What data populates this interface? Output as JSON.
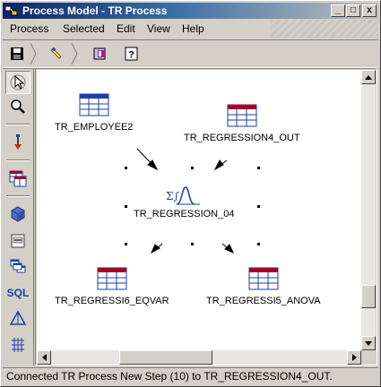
{
  "window": {
    "title": "Process Model - TR Process",
    "controls": {
      "minimize": "_",
      "maximize": "□",
      "close": "x"
    }
  },
  "menu": {
    "items": [
      "Process",
      "Selected",
      "Edit",
      "View",
      "Help"
    ]
  },
  "toolbar": {
    "buttons": [
      "save-icon",
      "hand-icon",
      "process-icon",
      "help-icon"
    ],
    "help_glyph": "?"
  },
  "palette": {
    "tools": [
      "pointer-icon",
      "zoom-icon",
      "link-icon",
      "table-source-icon",
      "cube-icon",
      "file-icon",
      "tables-icon",
      "sql-icon",
      "triangle-icon",
      "grid-icon"
    ],
    "sql_label": "SQL"
  },
  "canvas": {
    "nodes": {
      "employee2": "TR_EMPLOYEE2",
      "regression4_out": "TR_REGRESSION4_OUT",
      "regression_04": "TR_REGRESSION_04",
      "regressi6_eqvar": "TR_REGRESSI6_EQVAR",
      "regressi5_anova": "TR_REGRESSI5_ANOVA"
    },
    "step_glyph": "Σ∫"
  },
  "status": {
    "text": "Connected TR Process New Step (10) to TR_REGRESSION4_OUT."
  },
  "colors": {
    "title_bar": "#0a246a",
    "table_header": "#a80020",
    "table_grid": "#1a3fa8",
    "canvas": "#ffffff"
  }
}
